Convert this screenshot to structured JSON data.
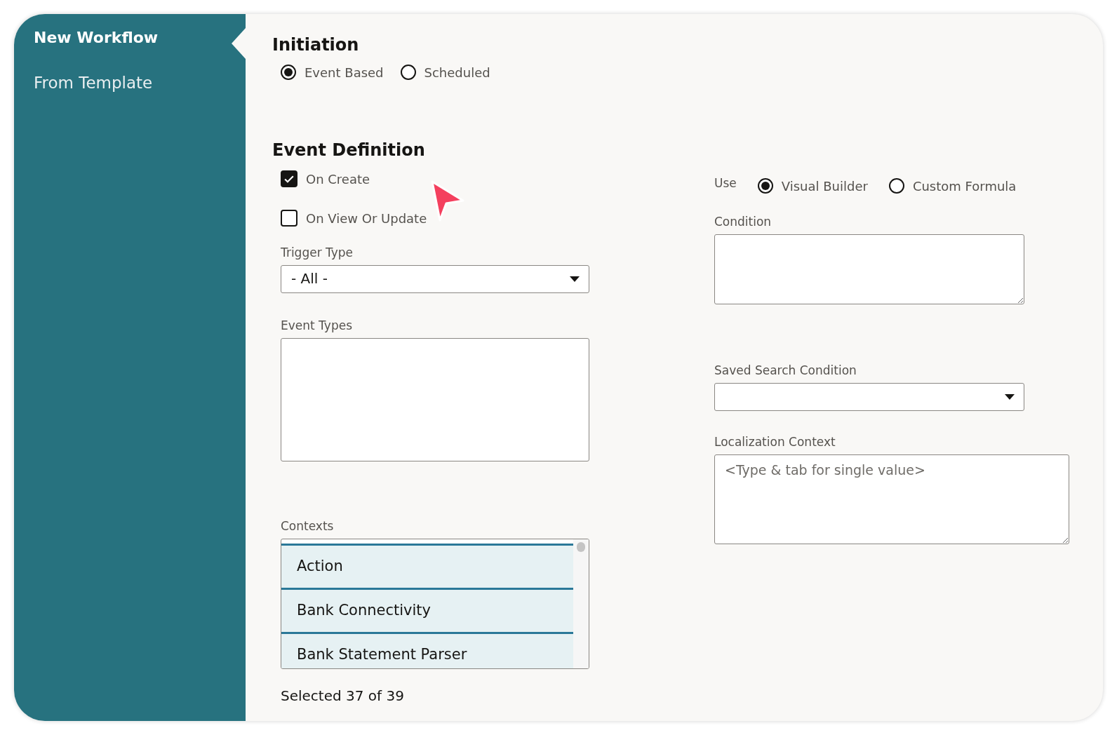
{
  "sidebar": {
    "items": [
      {
        "label": "New Workflow",
        "selected": true
      },
      {
        "label": "From Template",
        "selected": false
      }
    ]
  },
  "initiation": {
    "title": "Initiation",
    "options": [
      {
        "label": "Event Based",
        "selected": true
      },
      {
        "label": "Scheduled",
        "selected": false
      }
    ]
  },
  "event_definition": {
    "title": "Event Definition",
    "checkboxes": [
      {
        "label": "On Create",
        "checked": true
      },
      {
        "label": "On View Or Update",
        "checked": false
      }
    ],
    "trigger_type": {
      "label": "Trigger Type",
      "value": "- All -"
    },
    "event_types": {
      "label": "Event Types"
    },
    "contexts": {
      "label": "Contexts",
      "items": [
        {
          "label": "Action",
          "selected": true
        },
        {
          "label": "Bank Connectivity",
          "selected": true
        },
        {
          "label": "Bank Statement Parser",
          "selected": true
        }
      ],
      "summary": "Selected 37 of 39"
    },
    "use": {
      "label": "Use",
      "options": [
        {
          "label": "Visual Builder",
          "selected": true
        },
        {
          "label": "Custom Formula",
          "selected": false
        }
      ]
    },
    "condition": {
      "label": "Condition"
    },
    "saved_search_condition": {
      "label": "Saved Search Condition"
    },
    "localization_context": {
      "label": "Localization Context",
      "placeholder": "<Type & tab for single value>"
    }
  }
}
